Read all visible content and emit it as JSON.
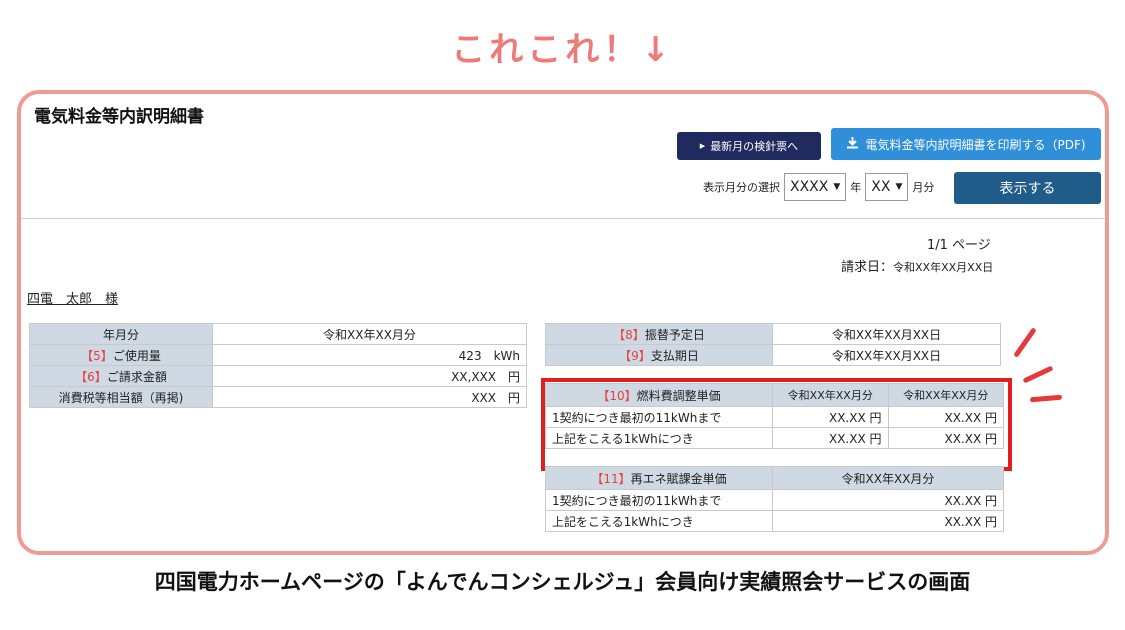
{
  "annotation": {
    "text": "これこれ！↓"
  },
  "header": {
    "title": "電気料金等内訳明細書",
    "latest_button": "最新月の検針票へ",
    "print_button": "電気料金等内訳明細書を印刷する（PDF)",
    "select_label": "表示月分の選択",
    "year_value": "XXXX",
    "year_unit": "年",
    "month_value": "XX",
    "month_unit": "月分",
    "show_button": "表示する"
  },
  "meta": {
    "page": "1/1 ページ",
    "bill_date_label": "請求日：",
    "bill_date": "令和XX年XX月XX日",
    "customer": "四電　太郎　様"
  },
  "summary": [
    {
      "num": "",
      "label": "年月分",
      "value": "令和XX年XX月分"
    },
    {
      "num": "【5】",
      "label": "ご使用量",
      "value": "423　kWh"
    },
    {
      "num": "【6】",
      "label": "ご請求金額",
      "value": "XX,XXX　円"
    },
    {
      "num": "",
      "label": "消費税等相当額（再掲)",
      "value": "XXX　円"
    }
  ],
  "dates": [
    {
      "num": "【8】",
      "label": "振替予定日",
      "value": "令和XX年XX月XX日"
    },
    {
      "num": "【9】",
      "label": "支払期日",
      "value": "令和XX年XX月XX日"
    }
  ],
  "fuel": {
    "num": "【10】",
    "title": "燃料費調整単価",
    "col1": "令和XX年XX月分",
    "col2": "令和XX年XX月分",
    "rows": [
      {
        "label": "1契約につき最初の11kWhまで",
        "v1": "XX.XX 円",
        "v2": "XX.XX 円"
      },
      {
        "label": "上記をこえる1kWhにつき",
        "v1": "XX.XX 円",
        "v2": "XX.XX 円"
      }
    ]
  },
  "renew": {
    "num": "【11】",
    "title": "再エネ賦課金単価",
    "col": "令和XX年XX月分",
    "rows": [
      {
        "label": "1契約につき最初の11kWhまで",
        "v": "XX.XX 円"
      },
      {
        "label": "上記をこえる1kWhにつき",
        "v": "XX.XX 円"
      }
    ]
  },
  "caption": "四国電力ホームページの「よんでんコンシェルジュ」会員向け実績照会サービスの画面",
  "colors": {
    "frame": "#f09a96",
    "highlight": "#e02020",
    "table_header": "#cfd9e3",
    "number": "#e64040"
  }
}
